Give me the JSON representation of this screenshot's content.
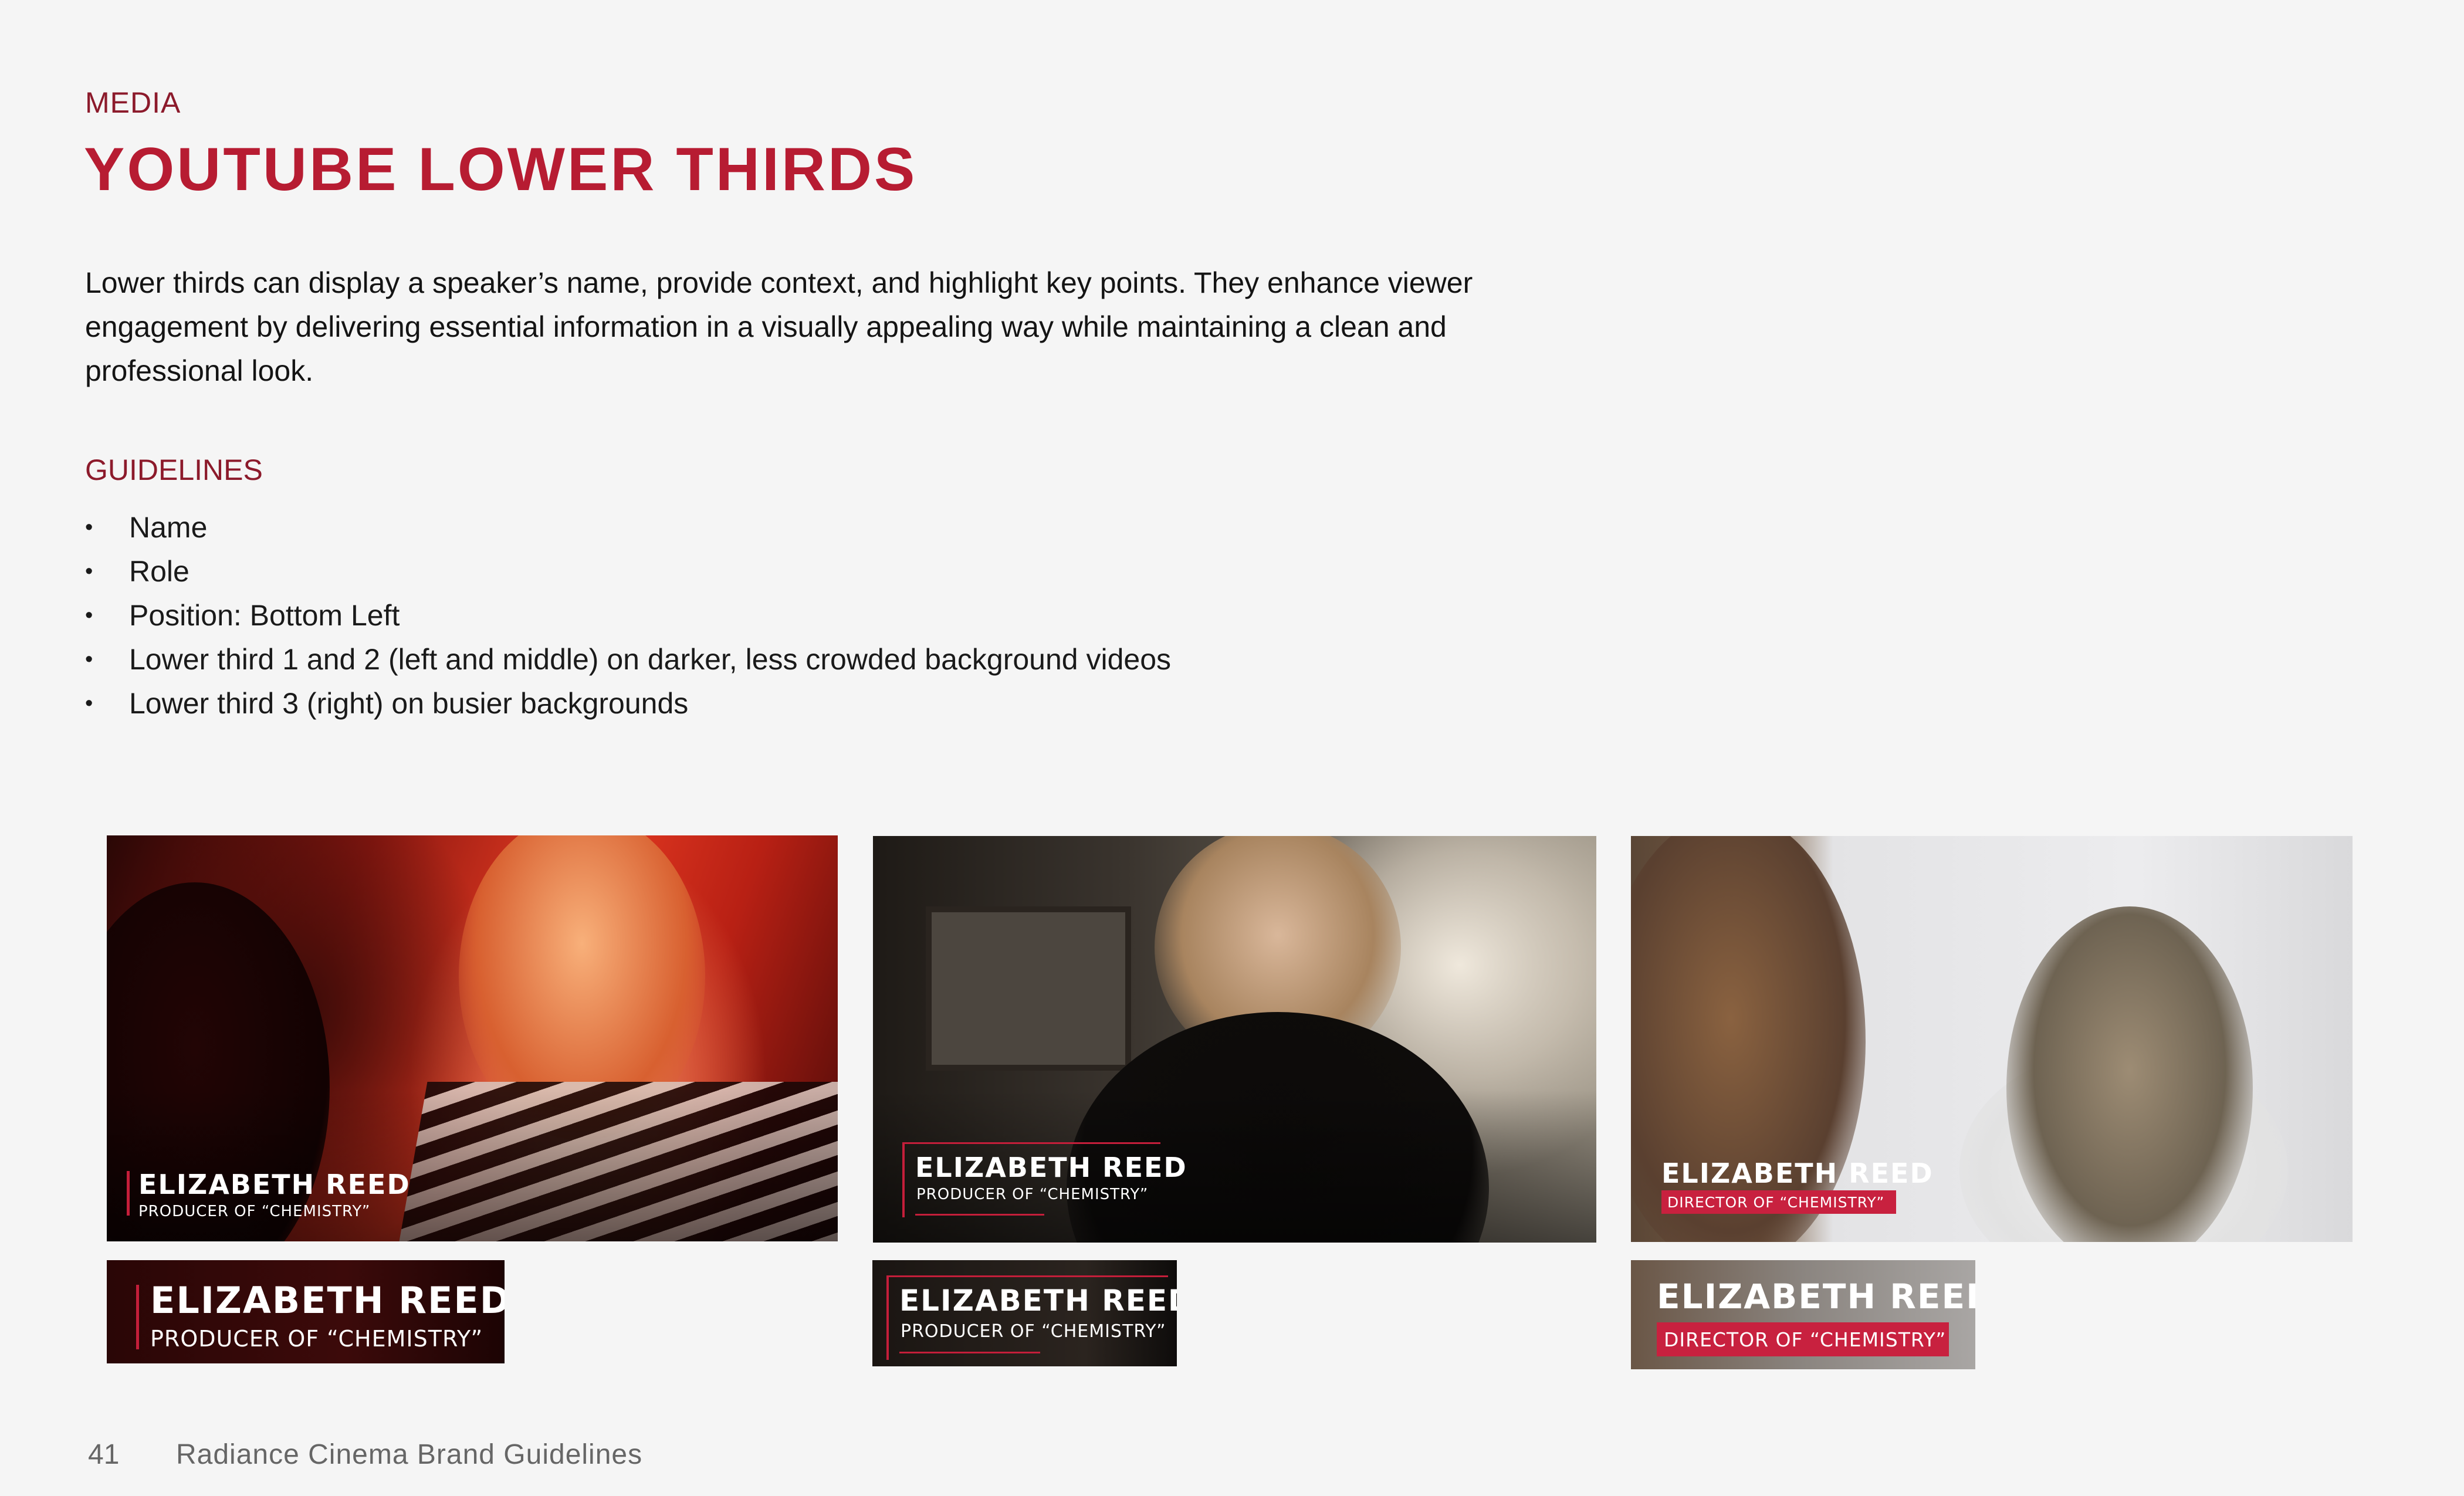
{
  "section_label": "MEDIA",
  "title": "YOUTUBE LOWER THIRDS",
  "intro": "Lower thirds can display a speaker’s name, provide context, and highlight key points. They enhance viewer engagement by delivering essential information in a visually appealing way while maintaining a clean and professional look.",
  "guidelines": {
    "label": "GUIDELINES",
    "items": [
      "Name",
      "Role",
      "Position: Bottom Left",
      "Lower third 1 and 2 (left and middle) on darker, less crowded background videos",
      "Lower third 3 (right) on busier backgrounds"
    ]
  },
  "examples": [
    {
      "name": "ELIZABETH REED",
      "role": "PRODUCER OF “CHEMISTRY”"
    },
    {
      "name": "ELIZABETH REED",
      "role": "PRODUCER OF “CHEMISTRY”"
    },
    {
      "name": "ELIZABETH REED",
      "role": "DIRECTOR OF “CHEMISTRY”"
    }
  ],
  "colors": {
    "accent": "#b71c32",
    "label": "#8c1a2b",
    "bar": "#c41e3a",
    "background": "#f5f5f5"
  },
  "footer": {
    "page_number": "41",
    "doc_title": "Radiance Cinema Brand Guidelines"
  }
}
